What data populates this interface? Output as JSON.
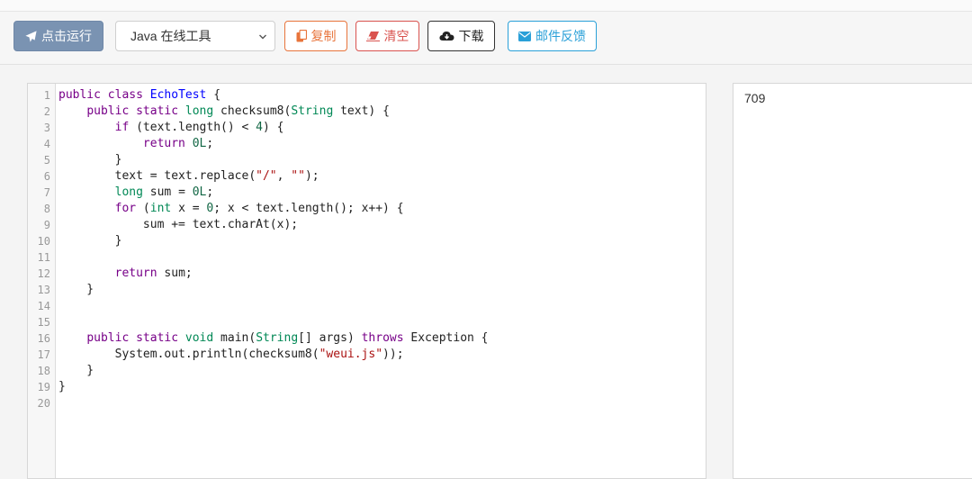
{
  "toolbar": {
    "run_label": "点击运行",
    "language_selected": "Java 在线工具",
    "copy_label": "复制",
    "clear_label": "清空",
    "download_label": "下载",
    "mail_label": "邮件反馈"
  },
  "icons": {
    "run": "paper-plane-icon",
    "copy": "copy-icon",
    "clear": "eraser-icon",
    "download": "cloud-download-icon",
    "mail": "envelope-icon",
    "select": "chevron-down-icon"
  },
  "colors": {
    "run": "#7a93b2",
    "copy": "#e8743b",
    "clear": "#d9534f",
    "download": "#333333",
    "mail": "#2aa0d8"
  },
  "editor": {
    "line_numbers": [
      "1",
      "2",
      "3",
      "4",
      "5",
      "6",
      "7",
      "8",
      "9",
      "10",
      "11",
      "12",
      "13",
      "14",
      "15",
      "16",
      "17",
      "18",
      "19",
      "20"
    ],
    "lines": [
      [
        {
          "t": "kw",
          "v": "public"
        },
        {
          "t": "p",
          "v": " "
        },
        {
          "t": "kw",
          "v": "class"
        },
        {
          "t": "p",
          "v": " "
        },
        {
          "t": "def",
          "v": "EchoTest"
        },
        {
          "t": "p",
          "v": " {"
        }
      ],
      [
        {
          "t": "p",
          "v": "    "
        },
        {
          "t": "kw",
          "v": "public"
        },
        {
          "t": "p",
          "v": " "
        },
        {
          "t": "kw",
          "v": "static"
        },
        {
          "t": "p",
          "v": " "
        },
        {
          "t": "ty",
          "v": "long"
        },
        {
          "t": "p",
          "v": " checksum8("
        },
        {
          "t": "ty",
          "v": "String"
        },
        {
          "t": "p",
          "v": " text) {"
        }
      ],
      [
        {
          "t": "p",
          "v": "        "
        },
        {
          "t": "kw",
          "v": "if"
        },
        {
          "t": "p",
          "v": " (text.length() < "
        },
        {
          "t": "num",
          "v": "4"
        },
        {
          "t": "p",
          "v": ") {"
        }
      ],
      [
        {
          "t": "p",
          "v": "            "
        },
        {
          "t": "kw",
          "v": "return"
        },
        {
          "t": "p",
          "v": " "
        },
        {
          "t": "num",
          "v": "0L"
        },
        {
          "t": "p",
          "v": ";"
        }
      ],
      [
        {
          "t": "p",
          "v": "        }"
        }
      ],
      [
        {
          "t": "p",
          "v": "        text = text.replace("
        },
        {
          "t": "str",
          "v": "\"/\""
        },
        {
          "t": "p",
          "v": ", "
        },
        {
          "t": "str",
          "v": "\"\""
        },
        {
          "t": "p",
          "v": ");"
        }
      ],
      [
        {
          "t": "p",
          "v": "        "
        },
        {
          "t": "ty",
          "v": "long"
        },
        {
          "t": "p",
          "v": " sum = "
        },
        {
          "t": "num",
          "v": "0L"
        },
        {
          "t": "p",
          "v": ";"
        }
      ],
      [
        {
          "t": "p",
          "v": "        "
        },
        {
          "t": "kw",
          "v": "for"
        },
        {
          "t": "p",
          "v": " ("
        },
        {
          "t": "ty",
          "v": "int"
        },
        {
          "t": "p",
          "v": " x = "
        },
        {
          "t": "num",
          "v": "0"
        },
        {
          "t": "p",
          "v": "; x < text.length(); x++) {"
        }
      ],
      [
        {
          "t": "p",
          "v": "            sum += text.charAt(x);"
        }
      ],
      [
        {
          "t": "p",
          "v": "        }"
        }
      ],
      [
        {
          "t": "p",
          "v": ""
        }
      ],
      [
        {
          "t": "p",
          "v": "        "
        },
        {
          "t": "kw",
          "v": "return"
        },
        {
          "t": "p",
          "v": " sum;"
        }
      ],
      [
        {
          "t": "p",
          "v": "    }"
        }
      ],
      [
        {
          "t": "p",
          "v": ""
        }
      ],
      [
        {
          "t": "p",
          "v": ""
        }
      ],
      [
        {
          "t": "p",
          "v": "    "
        },
        {
          "t": "kw",
          "v": "public"
        },
        {
          "t": "p",
          "v": " "
        },
        {
          "t": "kw",
          "v": "static"
        },
        {
          "t": "p",
          "v": " "
        },
        {
          "t": "ty",
          "v": "void"
        },
        {
          "t": "p",
          "v": " main("
        },
        {
          "t": "ty",
          "v": "String"
        },
        {
          "t": "p",
          "v": "[] args) "
        },
        {
          "t": "kw",
          "v": "throws"
        },
        {
          "t": "p",
          "v": " Exception {"
        }
      ],
      [
        {
          "t": "p",
          "v": "        System.out.println(checksum8("
        },
        {
          "t": "str",
          "v": "\"weui.js\""
        },
        {
          "t": "p",
          "v": "));"
        }
      ],
      [
        {
          "t": "p",
          "v": "    }"
        }
      ],
      [
        {
          "t": "p",
          "v": "}"
        }
      ],
      [
        {
          "t": "p",
          "v": ""
        }
      ]
    ]
  },
  "output": {
    "text": "709"
  }
}
